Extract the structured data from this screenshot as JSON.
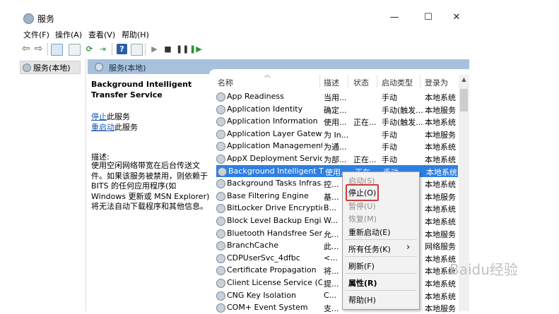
{
  "window": {
    "title": "服务"
  },
  "window_controls": {
    "minimize": "—",
    "maximize": "☐",
    "close": "✕"
  },
  "menu": [
    "文件(F)",
    "操作(A)",
    "查看(V)",
    "帮助(H)"
  ],
  "tree": {
    "item": "服务(本地)"
  },
  "panel": {
    "header": "服务(本地)"
  },
  "description": {
    "title": "Background Intelligent Transfer Service",
    "stop_link": "停止",
    "stop_suffix": "此服务",
    "restart_link": "重启动",
    "restart_suffix": "此服务",
    "label": "描述:",
    "text": "使用空闲网络带宽在后台传送文件。如果该服务被禁用，则依赖于 BITS 的任何应用程序(如 Windows 更新或 MSN Explorer)将无法自动下载程序和其他信息。"
  },
  "columns": {
    "name": "名称",
    "desc": "描述",
    "status": "状态",
    "startup": "启动类型",
    "logon": "登录为"
  },
  "rows": [
    {
      "name": "App Readiness",
      "desc": "当用...",
      "status": "",
      "startup": "手动",
      "logon": "本地系统",
      "selected": false
    },
    {
      "name": "Application Identity",
      "desc": "确定...",
      "status": "",
      "startup": "手动(触发...",
      "logon": "本地服务",
      "selected": false
    },
    {
      "name": "Application Information",
      "desc": "使用...",
      "status": "正在...",
      "startup": "手动(触发...",
      "logon": "本地系统",
      "selected": false
    },
    {
      "name": "Application Layer Gatewa...",
      "desc": "为 In...",
      "status": "",
      "startup": "手动",
      "logon": "本地服务",
      "selected": false
    },
    {
      "name": "Application Management",
      "desc": "为通...",
      "status": "",
      "startup": "手动",
      "logon": "本地系统",
      "selected": false
    },
    {
      "name": "AppX Deployment Servic...",
      "desc": "为部...",
      "status": "正在...",
      "startup": "手动",
      "logon": "本地系统",
      "selected": false
    },
    {
      "name": "Background Intelligent T...",
      "desc": "使用...",
      "status": "正在...",
      "startup": "手动",
      "logon": "本地系统",
      "selected": true
    },
    {
      "name": "Background Tasks Infras...",
      "desc": "控...",
      "status": "",
      "startup": "",
      "logon": "本地系统",
      "selected": false
    },
    {
      "name": "Base Filtering Engine",
      "desc": "基...",
      "status": "",
      "startup": "",
      "logon": "本地服务",
      "selected": false
    },
    {
      "name": "BitLocker Drive Encryptio...",
      "desc": "B...",
      "status": "",
      "startup": "",
      "logon": "本地系统",
      "selected": false
    },
    {
      "name": "Block Level Backup Engi...",
      "desc": "W...",
      "status": "",
      "startup": "",
      "logon": "本地系统",
      "selected": false
    },
    {
      "name": "Bluetooth Handsfree Ser...",
      "desc": "允...",
      "status": "",
      "startup": "",
      "logon": "本地服务",
      "selected": false
    },
    {
      "name": "BranchCache",
      "desc": "此...",
      "status": "",
      "startup": "",
      "logon": "网络服务",
      "selected": false
    },
    {
      "name": "CDPUserSvc_4dfbc",
      "desc": "<...",
      "status": "",
      "startup": "",
      "logon": "本地系统",
      "selected": false
    },
    {
      "name": "Certificate Propagation",
      "desc": "将...",
      "status": "",
      "startup": "",
      "logon": "本地系统",
      "selected": false
    },
    {
      "name": "Client License Service (Cli...",
      "desc": "提...",
      "status": "",
      "startup": "",
      "logon": "本地系统",
      "selected": false
    },
    {
      "name": "CNG Key Isolation",
      "desc": "C...",
      "status": "",
      "startup": "",
      "logon": "本地系统",
      "selected": false
    },
    {
      "name": "COM+ Event System",
      "desc": "支...",
      "status": "",
      "startup": "",
      "logon": "本地服务",
      "selected": false
    }
  ],
  "context_menu": {
    "start": "启动(S)",
    "stop": "停止(O)",
    "pause": "暂停(U)",
    "resume": "恢复(M)",
    "restart": "重新启动(E)",
    "all_tasks": "所有任务(K)",
    "all_tasks_arrow": "›",
    "refresh": "刷新(F)",
    "properties": "属性(R)",
    "help": "帮助(H)"
  },
  "watermark": "Baidu经验"
}
